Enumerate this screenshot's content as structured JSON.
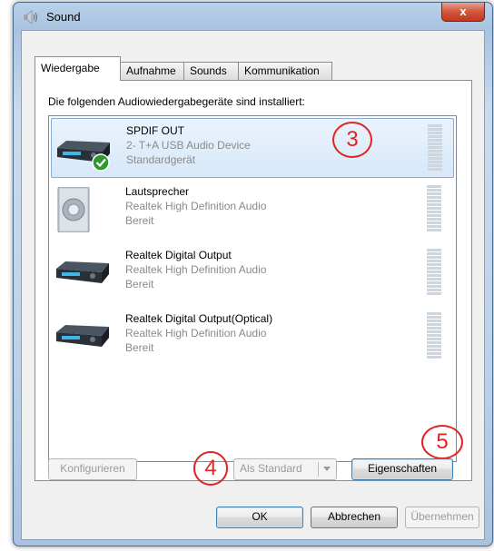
{
  "window": {
    "title": "Sound",
    "close_label": "x"
  },
  "tabs": [
    {
      "label": "Wiedergabe",
      "active": true
    },
    {
      "label": "Aufnahme",
      "active": false
    },
    {
      "label": "Sounds",
      "active": false
    },
    {
      "label": "Kommunikation",
      "active": false
    }
  ],
  "panel": {
    "instruction": "Die folgenden Audiowiedergabegeräte sind installiert:"
  },
  "devices": [
    {
      "name": "SPDIF OUT",
      "description": "2- T+A USB Audio Device",
      "status": "Standardgerät",
      "icon": "audio-receiver-icon",
      "selected": true,
      "default": true
    },
    {
      "name": "Lautsprecher",
      "description": "Realtek High Definition Audio",
      "status": "Bereit",
      "icon": "speaker-icon",
      "selected": false,
      "default": false
    },
    {
      "name": "Realtek Digital Output",
      "description": "Realtek High Definition Audio",
      "status": "Bereit",
      "icon": "audio-receiver-icon",
      "selected": false,
      "default": false
    },
    {
      "name": "Realtek Digital Output(Optical)",
      "description": "Realtek High Definition Audio",
      "status": "Bereit",
      "icon": "audio-receiver-icon",
      "selected": false,
      "default": false
    }
  ],
  "annotations": [
    "3",
    "4",
    "5"
  ],
  "buttons": {
    "configure": "Konfigurieren",
    "set_default": "Als Standard",
    "properties": "Eigenschaften",
    "ok": "OK",
    "cancel": "Abbrechen",
    "apply": "Übernehmen"
  },
  "colors": {
    "annotation": "#e32222",
    "selection": "#d7e8f9",
    "check": "#2e9a2e"
  }
}
